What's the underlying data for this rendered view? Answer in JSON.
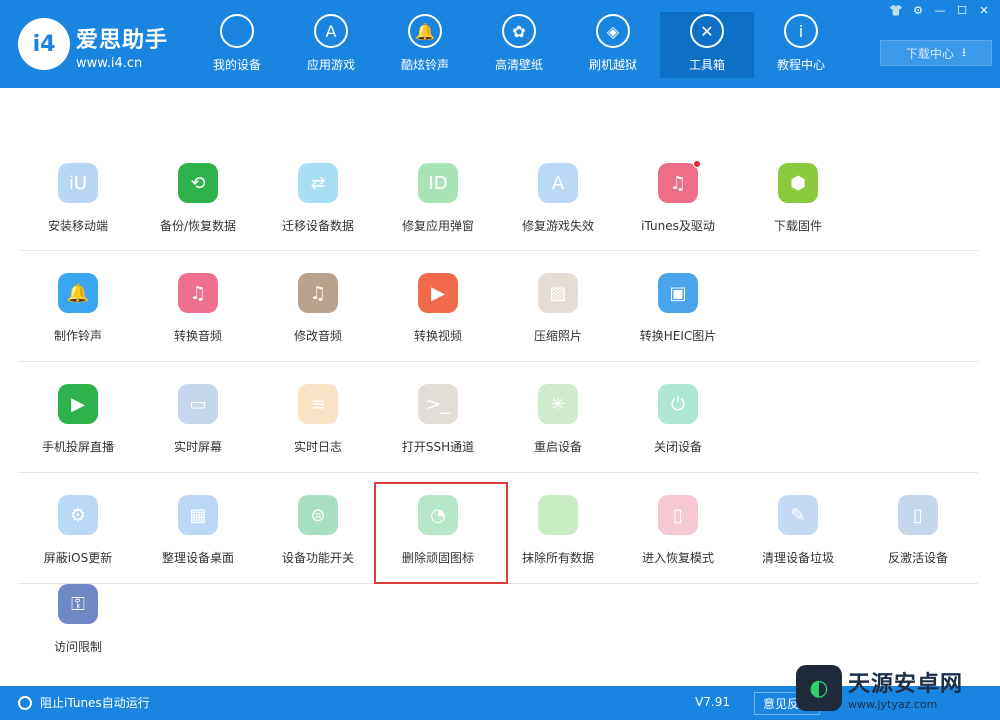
{
  "app": {
    "name": "爱思助手",
    "url": "www.i4.cn",
    "logo_text": "i4"
  },
  "nav": [
    {
      "label": "我的设备",
      "icon": "apple-icon",
      "glyph": ""
    },
    {
      "label": "应用游戏",
      "icon": "app-store-icon",
      "glyph": "A"
    },
    {
      "label": "酷炫铃声",
      "icon": "bell-icon",
      "glyph": "🔔"
    },
    {
      "label": "高清壁纸",
      "icon": "flower-icon",
      "glyph": "✿"
    },
    {
      "label": "刷机越狱",
      "icon": "box-icon",
      "glyph": "◈"
    },
    {
      "label": "工具箱",
      "icon": "tools-icon",
      "glyph": "✕",
      "active": true
    },
    {
      "label": "教程中心",
      "icon": "info-icon",
      "glyph": "i"
    }
  ],
  "download_center": {
    "label": "下载中心",
    "icon": "download-icon"
  },
  "window_controls": [
    "shirt-icon",
    "gear-icon",
    "minimize-icon",
    "maximize-icon",
    "close-icon"
  ],
  "tools": [
    [
      {
        "label": "安装移动端",
        "color": "#b9d6f5",
        "icon": "i4-mobile-icon",
        "glyph": "iU"
      },
      {
        "label": "备份/恢复数据",
        "color": "#2fb24c",
        "icon": "backup-clock-icon",
        "glyph": "⟲"
      },
      {
        "label": "迁移设备数据",
        "color": "#a8dff2",
        "icon": "transfer-icon",
        "glyph": "⇄"
      },
      {
        "label": "修复应用弹窗",
        "color": "#a9e4b8",
        "icon": "apple-id-icon",
        "glyph": "ID"
      },
      {
        "label": "修复游戏失效",
        "color": "#bcd8f7",
        "icon": "app-store-icon",
        "glyph": "A"
      },
      {
        "label": "iTunes及驱动",
        "color": "#ee6e87",
        "icon": "itunes-icon",
        "glyph": "♫",
        "badge": true
      },
      {
        "label": "下载固件",
        "color": "#8bca3f",
        "icon": "cube-icon",
        "glyph": "⬢"
      }
    ],
    [
      {
        "label": "制作铃声",
        "color": "#3aa5f0",
        "icon": "bell-plus-icon",
        "glyph": "🔔"
      },
      {
        "label": "转换音频",
        "color": "#ef6f8e",
        "icon": "music-icon",
        "glyph": "♫"
      },
      {
        "label": "修改音频",
        "color": "#b8a28d",
        "icon": "music-edit-icon",
        "glyph": "♫"
      },
      {
        "label": "转换视频",
        "color": "#f06b4b",
        "icon": "play-icon",
        "glyph": "▶"
      },
      {
        "label": "压缩照片",
        "color": "#e5ddd3",
        "icon": "photo-icon",
        "glyph": "▨"
      },
      {
        "label": "转换HEIC图片",
        "color": "#4aa4ec",
        "icon": "image-convert-icon",
        "glyph": "▣"
      }
    ],
    [
      {
        "label": "手机投屏直播",
        "color": "#2fb24c",
        "icon": "screen-cast-icon",
        "glyph": "▶"
      },
      {
        "label": "实时屏幕",
        "color": "#c6d7ec",
        "icon": "monitor-icon",
        "glyph": "▭"
      },
      {
        "label": "实时日志",
        "color": "#f8e2c6",
        "icon": "log-icon",
        "glyph": "≡"
      },
      {
        "label": "打开SSH通道",
        "color": "#e2ddd6",
        "icon": "terminal-icon",
        "glyph": ">_"
      },
      {
        "label": "重启设备",
        "color": "#cfeacd",
        "icon": "restart-icon",
        "glyph": "✳"
      },
      {
        "label": "关闭设备",
        "color": "#aee7d6",
        "icon": "power-icon",
        "glyph": "⏻"
      }
    ],
    [
      {
        "label": "屏蔽iOS更新",
        "color": "#bcd8f7",
        "icon": "block-update-icon",
        "glyph": "⚙"
      },
      {
        "label": "整理设备桌面",
        "color": "#bcd8f7",
        "icon": "grid-icon",
        "glyph": "▦"
      },
      {
        "label": "设备功能开关",
        "color": "#a9dfc1",
        "icon": "toggle-icon",
        "glyph": "⊜"
      },
      {
        "label": "删除顽固图标",
        "color": "#b7e7c9",
        "icon": "pie-icon",
        "glyph": "◔"
      },
      {
        "label": "抹除所有数据",
        "color": "#c9ebc3",
        "icon": "apple-icon",
        "glyph": ""
      },
      {
        "label": "进入恢复模式",
        "color": "#f6c8d4",
        "icon": "phone-recovery-icon",
        "glyph": "▯"
      },
      {
        "label": "清理设备垃圾",
        "color": "#c5d9f3",
        "icon": "broom-icon",
        "glyph": "✎"
      },
      {
        "label": "反激活设备",
        "color": "#c6d7ec",
        "icon": "deactivate-icon",
        "glyph": "▯"
      }
    ],
    [
      {
        "label": "访问限制",
        "color": "#6f87c4",
        "icon": "key-icon",
        "glyph": "⚿"
      }
    ]
  ],
  "footer": {
    "itunes_toggle": "阻止iTunes自动运行",
    "version": "V7.91",
    "feedback": "意见反馈"
  },
  "watermark": {
    "name": "天源安卓网",
    "url": "www.jytyaz.com"
  }
}
